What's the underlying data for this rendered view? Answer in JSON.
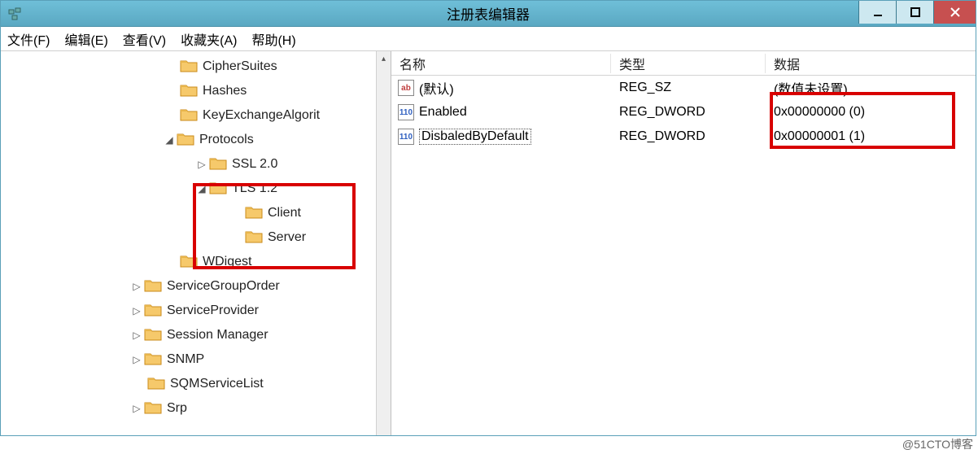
{
  "window": {
    "title": "注册表编辑器"
  },
  "menu": {
    "file": "文件(F)",
    "edit": "编辑(E)",
    "view": "查看(V)",
    "favorites": "收藏夹(A)",
    "help": "帮助(H)"
  },
  "tree": {
    "items": [
      {
        "label": "CipherSuites",
        "indent": 220,
        "toggle": ""
      },
      {
        "label": "Hashes",
        "indent": 220,
        "toggle": ""
      },
      {
        "label": "KeyExchangeAlgorit",
        "indent": 220,
        "toggle": ""
      },
      {
        "label": "Protocols",
        "indent": 220,
        "toggle": "◢",
        "toggleIndent": 200
      },
      {
        "label": "SSL 2.0",
        "indent": 260,
        "toggle": "▷",
        "toggleIndent": 240
      },
      {
        "label": "TLS 1.2",
        "indent": 260,
        "toggle": "◢",
        "toggleIndent": 240
      },
      {
        "label": "Client",
        "indent": 300,
        "toggle": ""
      },
      {
        "label": "Server",
        "indent": 300,
        "toggle": ""
      },
      {
        "label": "WDigest",
        "indent": 220,
        "toggle": ""
      },
      {
        "label": "ServiceGroupOrder",
        "indent": 180,
        "toggle": "▷",
        "toggleIndent": 160
      },
      {
        "label": "ServiceProvider",
        "indent": 180,
        "toggle": "▷",
        "toggleIndent": 160
      },
      {
        "label": "Session Manager",
        "indent": 180,
        "toggle": "▷",
        "toggleIndent": 160
      },
      {
        "label": "SNMP",
        "indent": 180,
        "toggle": "▷",
        "toggleIndent": 160
      },
      {
        "label": "SQMServiceList",
        "indent": 180,
        "toggle": ""
      },
      {
        "label": "Srp",
        "indent": 180,
        "toggle": "▷",
        "toggleIndent": 160
      }
    ]
  },
  "list": {
    "headers": {
      "name": "名称",
      "type": "类型",
      "data": "数据"
    },
    "rows": [
      {
        "icon": "str",
        "name": "(默认)",
        "type": "REG_SZ",
        "data": "(数值未设置)",
        "selected": false
      },
      {
        "icon": "bin",
        "name": "Enabled",
        "type": "REG_DWORD",
        "data": "0x00000000 (0)",
        "selected": false
      },
      {
        "icon": "bin",
        "name": "DisbaledByDefault",
        "type": "REG_DWORD",
        "data": "0x00000001 (1)",
        "selected": true
      }
    ]
  },
  "branding": "@51CTO博客"
}
